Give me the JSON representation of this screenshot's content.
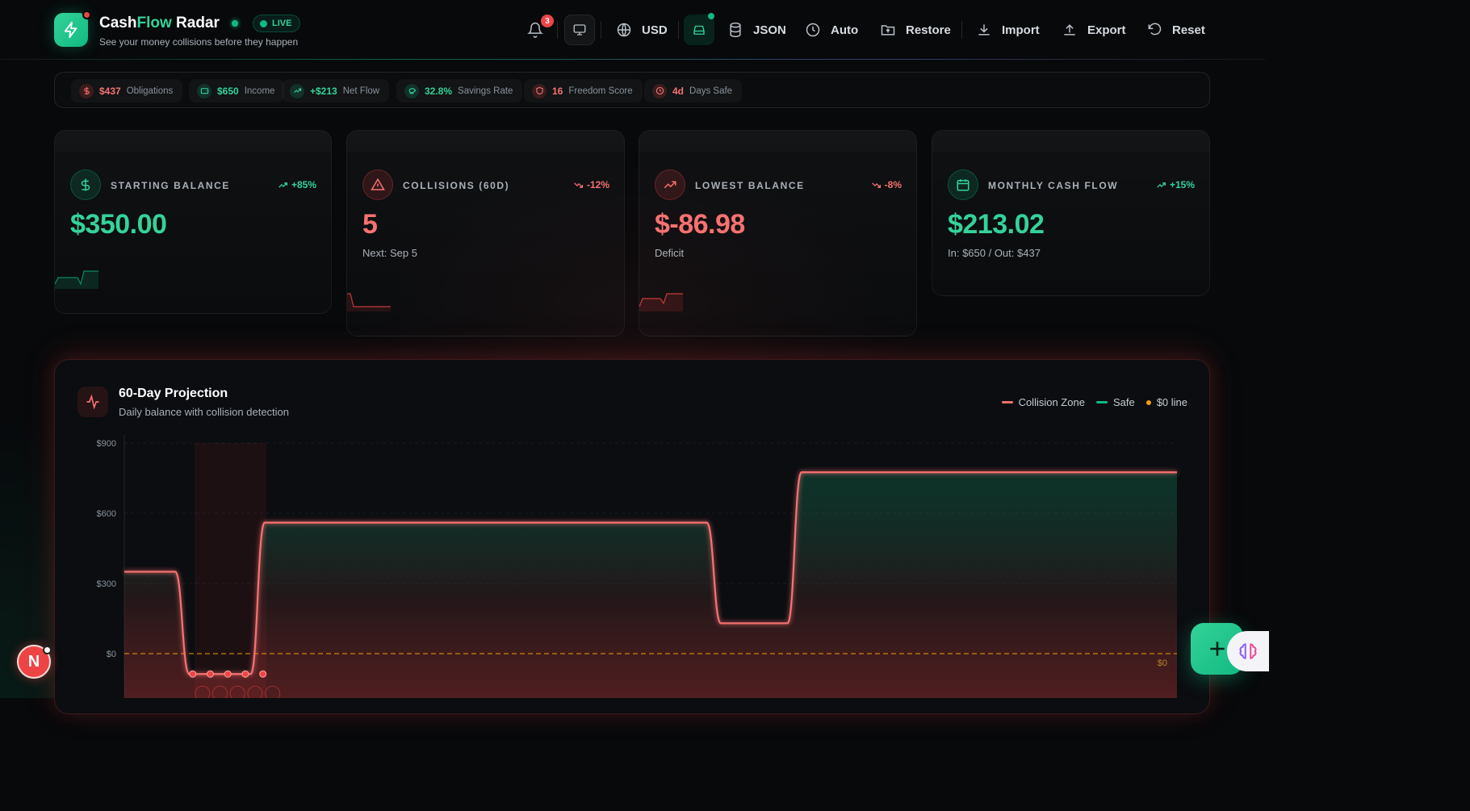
{
  "app": {
    "brand_main": "Cash",
    "brand_accent": "Flow",
    "brand_rest": " Radar",
    "tagline": "See your money collisions before they happen",
    "live_label": "LIVE"
  },
  "toolbar": {
    "notifications_count": "3",
    "currency": "USD",
    "json": "JSON",
    "auto": "Auto",
    "restore": "Restore",
    "import": "Import",
    "export": "Export",
    "reset": "Reset"
  },
  "stats": [
    {
      "value": "$437",
      "label": "Obligations",
      "tone": "red",
      "icon": "dollar-icon"
    },
    {
      "value": "$650",
      "label": "Income",
      "tone": "green",
      "icon": "wallet-icon"
    },
    {
      "value": "+$213",
      "label": "Net Flow",
      "tone": "green",
      "icon": "trend-up-icon"
    },
    {
      "value": "32.8%",
      "label": "Savings Rate",
      "tone": "green",
      "icon": "piggy-bank-icon"
    },
    {
      "value": "16",
      "label": "Freedom Score",
      "tone": "red",
      "icon": "shield-icon"
    },
    {
      "value": "4d",
      "label": "Days Safe",
      "tone": "red",
      "icon": "clock-icon"
    }
  ],
  "cards": [
    {
      "title": "STARTING BALANCE",
      "trend": "+85%",
      "trend_dir": "up",
      "value": "$350.00",
      "sub": "",
      "tone": "green",
      "icon": "dollar-icon"
    },
    {
      "title": "COLLISIONS (60D)",
      "trend": "-12%",
      "trend_dir": "down",
      "value": "5",
      "sub": "Next: Sep 5",
      "tone": "red",
      "icon": "warning-icon"
    },
    {
      "title": "LOWEST BALANCE",
      "trend": "-8%",
      "trend_dir": "down",
      "value": "$-86.98",
      "sub": "Deficit",
      "tone": "red",
      "icon": "trend-up-icon"
    },
    {
      "title": "MONTHLY CASH FLOW",
      "trend": "+15%",
      "trend_dir": "up",
      "value": "$213.02",
      "sub": "In: $650 / Out: $437",
      "tone": "green",
      "icon": "calendar-icon"
    }
  ],
  "projection": {
    "title": "60-Day Projection",
    "subtitle": "Daily balance with collision detection",
    "legend": [
      {
        "label": "Collision Zone",
        "color": "#f87171"
      },
      {
        "label": "Safe",
        "color": "#10b981"
      },
      {
        "label": "$0 line",
        "color": "#f59e0b"
      }
    ],
    "zero_label": "$0"
  },
  "chart_data": {
    "type": "area",
    "title": "60-Day Projection",
    "subtitle": "Daily balance with collision detection",
    "y_ticks": [
      "$900",
      "$600",
      "$300",
      "$0"
    ],
    "ylim": [
      -150,
      900
    ],
    "xlim": [
      0,
      60
    ],
    "points": [
      [
        0,
        350
      ],
      [
        2.9,
        350
      ],
      [
        3.7,
        -87
      ],
      [
        7.2,
        -87
      ],
      [
        8.0,
        560
      ],
      [
        33.2,
        560
      ],
      [
        34.0,
        130
      ],
      [
        37.8,
        130
      ],
      [
        38.6,
        775
      ],
      [
        60,
        775
      ]
    ],
    "collision_markers": [
      3.9,
      4.9,
      5.9,
      6.9,
      7.9
    ],
    "collision_zone": [
      4.0,
      8.1
    ]
  },
  "user": {
    "initial": "N"
  }
}
